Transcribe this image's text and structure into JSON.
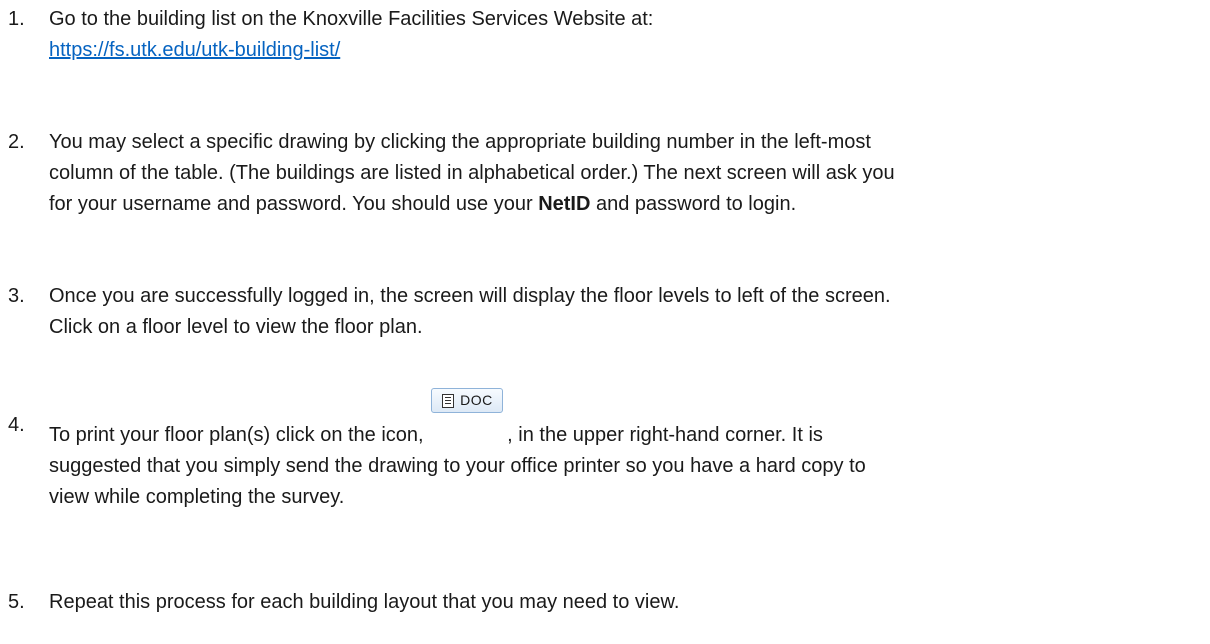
{
  "steps": [
    {
      "number": "1.",
      "text": "Go to the building list on the Knoxville Facilities Services Website at:",
      "link": "https://fs.utk.edu/utk-building-list/"
    },
    {
      "number": "2.",
      "line1": "You may select a specific drawing by clicking the appropriate building number in the left-most",
      "line2": "column of the table. (The buildings are listed in alphabetical order.) The next screen will ask you",
      "line3_before": "for your username and password. You should use your ",
      "line3_bold": "NetID",
      "line3_after": " and password to login."
    },
    {
      "number": "3.",
      "line1": "Once you are successfully logged in, the screen will display the floor levels to left of the screen.",
      "line2": "Click on a floor level to view the floor plan."
    },
    {
      "number": "4.",
      "line1_before": "To print your floor plan(s) click on the icon, ",
      "line1_after": ", in the upper right-hand corner. It is",
      "line2": "suggested that you simply send the drawing to your office printer so you have a hard copy to",
      "line3": "view while completing the survey.",
      "button_label": "DOC",
      "button_icon": "document-icon"
    },
    {
      "number": "5.",
      "text": "Repeat this process for each building layout that you may need to view."
    }
  ],
  "colors": {
    "link": "#0563c1",
    "text": "#1a1a1a"
  }
}
